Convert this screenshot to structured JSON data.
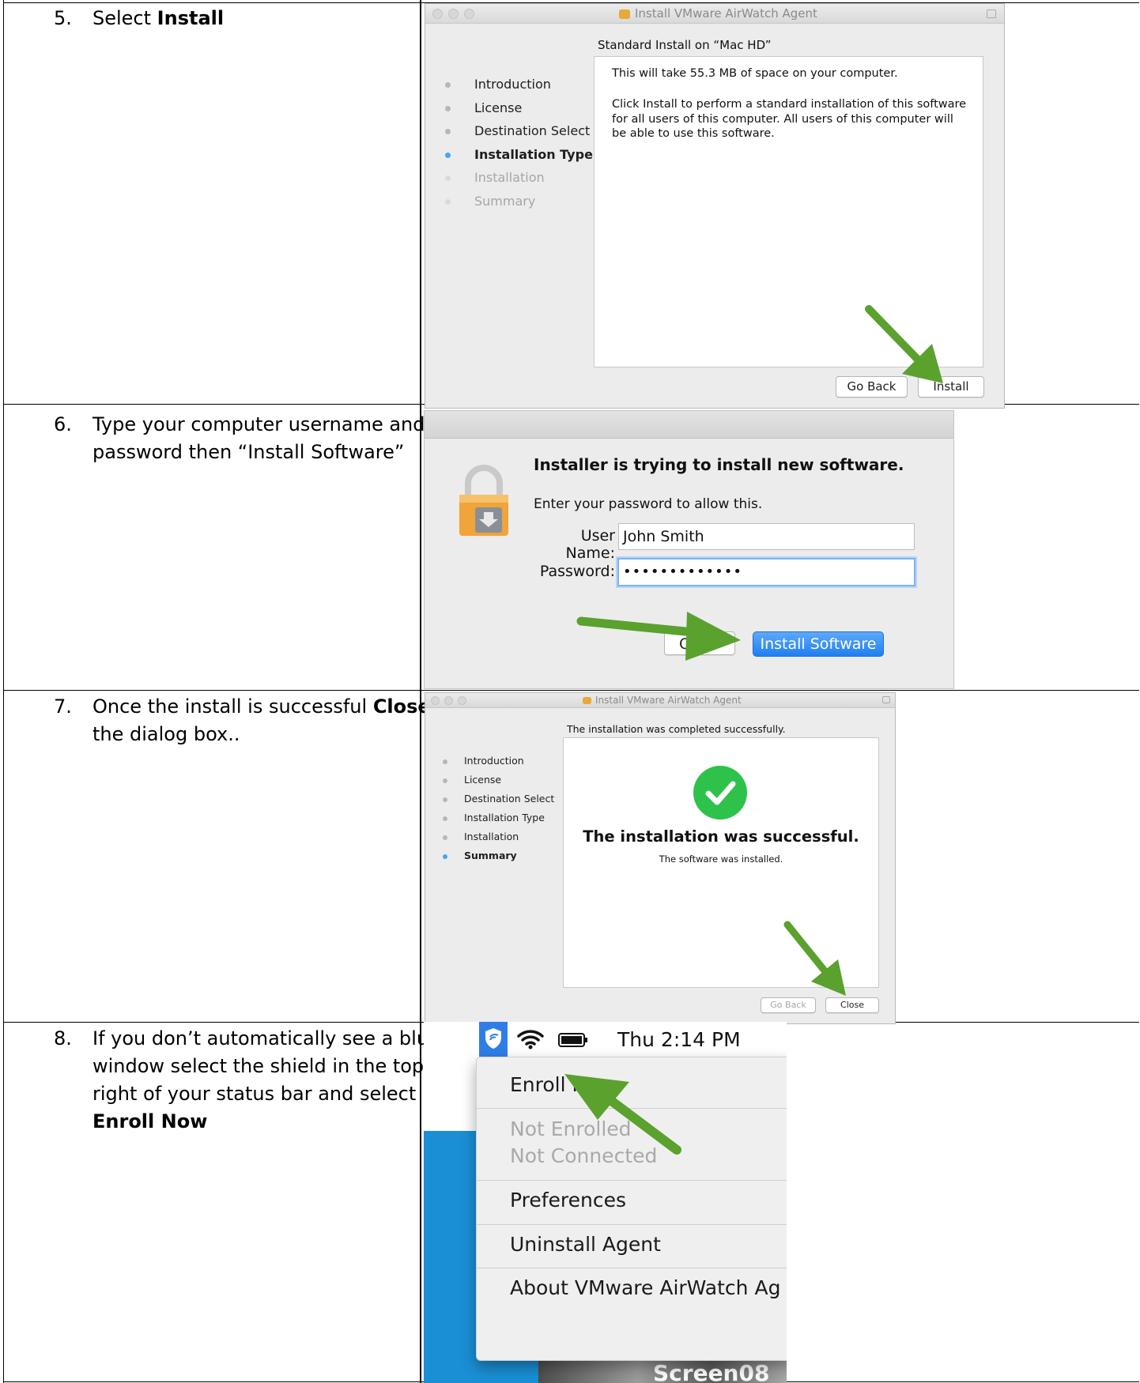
{
  "steps": [
    {
      "num": "5.",
      "pre": "Select ",
      "bold": "Install",
      "post": ""
    },
    {
      "num": "6.",
      "pre": "Type your computer username and password then “Install Software”",
      "bold": "",
      "post": ""
    },
    {
      "num": "7.",
      "pre": "Once the install is successful ",
      "bold": "Close",
      "post": " the dialog box.."
    },
    {
      "num": "8.",
      "pre": "If you don’t automatically see a blue window select the shield in the top right of your status bar and select ",
      "bold": "Enroll Now",
      "post": ""
    }
  ],
  "installer1": {
    "window_title": "Install VMware AirWatch Agent",
    "subtitle": "Standard Install on “Mac HD”",
    "sidebar": [
      "Introduction",
      "License",
      "Destination Select",
      "Installation Type",
      "Installation",
      "Summary"
    ],
    "active_step": "Installation Type",
    "body_line1": "This will take 55.3 MB of space on your computer.",
    "body_line2": "Click Install to perform a standard installation of this software for all users of this computer. All users of this computer will be able to use this software.",
    "back_button": "Go Back",
    "primary_button": "Install"
  },
  "auth_dialog": {
    "heading": "Installer is trying to install new software.",
    "prompt": "Enter your password to allow this.",
    "username_label": "User Name:",
    "username_value": "John Smith",
    "password_label": "Password:",
    "password_value": "•••••••••••••",
    "cancel_button": "Canc",
    "primary_button": "Install Software",
    "accent_color": "#1f7ff0"
  },
  "installer2": {
    "window_title": "Install VMware AirWatch Agent",
    "subtitle": "The installation was completed successfully.",
    "sidebar": [
      "Introduction",
      "License",
      "Destination Select",
      "Installation Type",
      "Installation",
      "Summary"
    ],
    "active_step": "Summary",
    "success_heading": "The installation was successful.",
    "success_sub": "The software was installed.",
    "back_button": "Go Back",
    "primary_button": "Close",
    "success_color": "#2ec24a"
  },
  "menubar": {
    "clock": "Thu 2:14 PM",
    "menu": {
      "enroll": "Enroll Now",
      "status1": "Not Enrolled",
      "status2": "Not Connected",
      "preferences": "Preferences",
      "uninstall": "Uninstall Agent",
      "about": "About VMware AirWatch Ag"
    },
    "desktop_label": "Screen08"
  },
  "arrow_color": "#5aa12e"
}
